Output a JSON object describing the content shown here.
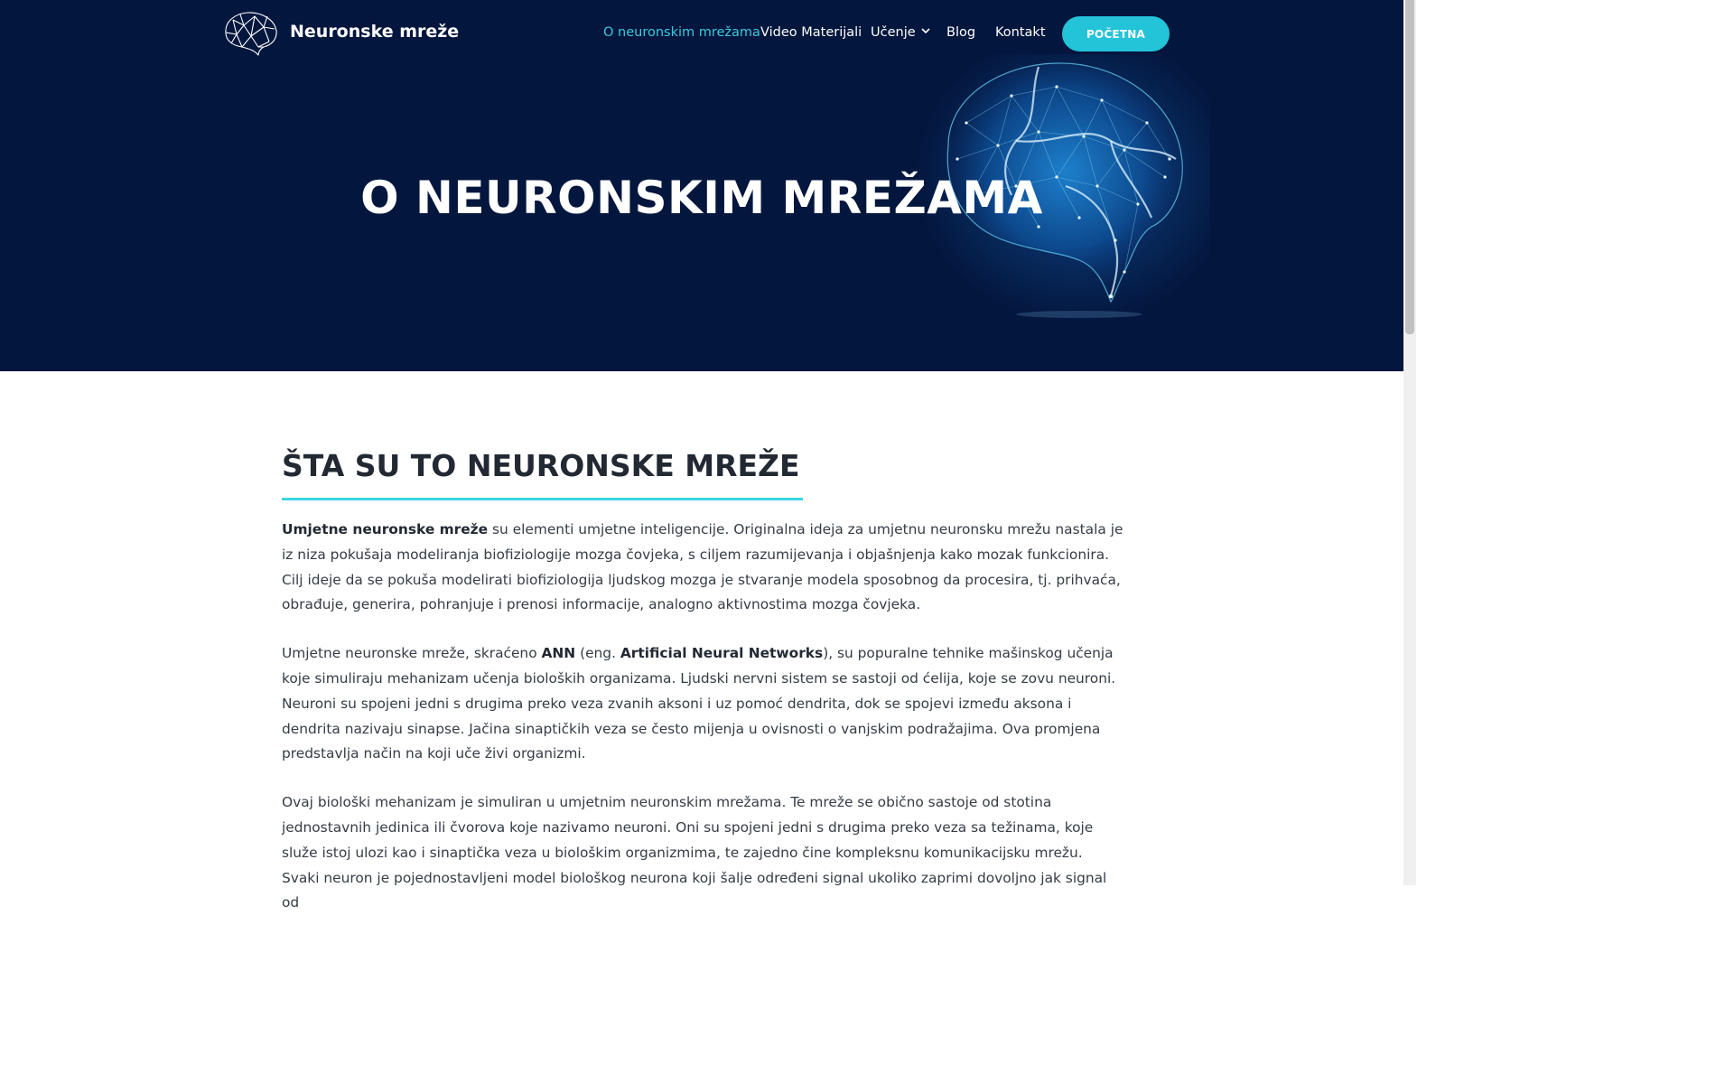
{
  "header": {
    "logo_text": "Neuronske mreže",
    "nav": [
      {
        "label": "O neuronskim mrežama",
        "active": true
      },
      {
        "label": "Video Materijali",
        "active": false
      },
      {
        "label": "Učenje",
        "active": false,
        "has_dropdown": true
      },
      {
        "label": "Blog",
        "active": false
      },
      {
        "label": "Kontakt",
        "active": false
      }
    ],
    "cta_label": "POČETNA"
  },
  "hero": {
    "title": "O NEURONSKIM MREŽAMA"
  },
  "main": {
    "section_title": "ŠTA SU TO NEURONSKE MREŽE",
    "p1": {
      "bold_lead": "Umjetne neuronske mreže",
      "rest": " su elementi umjetne inteligencije. Originalna ideja za umjetnu neuronsku mrežu nastala je iz niza pokušaja modeliranja biofiziologije mozga čovjeka, s ciljem razumijevanja i objašnjenja kako mozak funkcionira. Cilj ideje da se pokuša modelirati biofiziologija ljudskog mozga je stvaranje modela sposobnog da procesira, tj. prihvaća, obrađuje, generira, pohranjuje i prenosi informacije, analogno aktivnostima mozga čovjeka."
    },
    "p2": {
      "t1": "Umjetne neuronske mreže, skraćeno ",
      "b1": "ANN",
      "t2": " (eng. ",
      "b2": "Artificial Neural Networks",
      "t3": "), su popuralne tehnike mašinskog učenja koje simuliraju mehanizam učenja bioloških  organizama. Ljudski nervni sistem se sastoji od ćelija, koje se zovu neuroni. Neuroni su spojeni jedni s drugima preko veza zvanih aksoni i uz pomoć dendrita, dok se spojevi između aksona i dendrita nazivaju sinapse. Jačina sinaptičkih veza se često mijenja u ovisnosti o vanjskim podražajima. Ova promjena predstavlja način na koji uče živi organizmi."
    },
    "p3": "Ovaj biološki mehanizam je simuliran u umjetnim neuronskim mrežama. Te mreže se obično sastoje od stotina jednostavnih jedinica ili čvorova koje nazivamo neuroni. Oni su spojeni jedni s drugima preko veza sa težinama, koje služe istoj ulozi kao i sinaptička veza u biološkim organizmima, te zajedno čine kompleksnu komunikacijsku mrežu. Svaki neuron je pojednostavljeni model biološkog neurona koji šalje određeni signal ukoliko zaprimi dovoljno jak signal od"
  },
  "colors": {
    "hero_bg": "#03163d",
    "accent": "#23c3d8",
    "active_nav": "#3cc9dc",
    "underline": "#3cd5e3"
  },
  "icons": {
    "logo": "brain-network-icon",
    "dropdown": "chevron-down-icon"
  }
}
